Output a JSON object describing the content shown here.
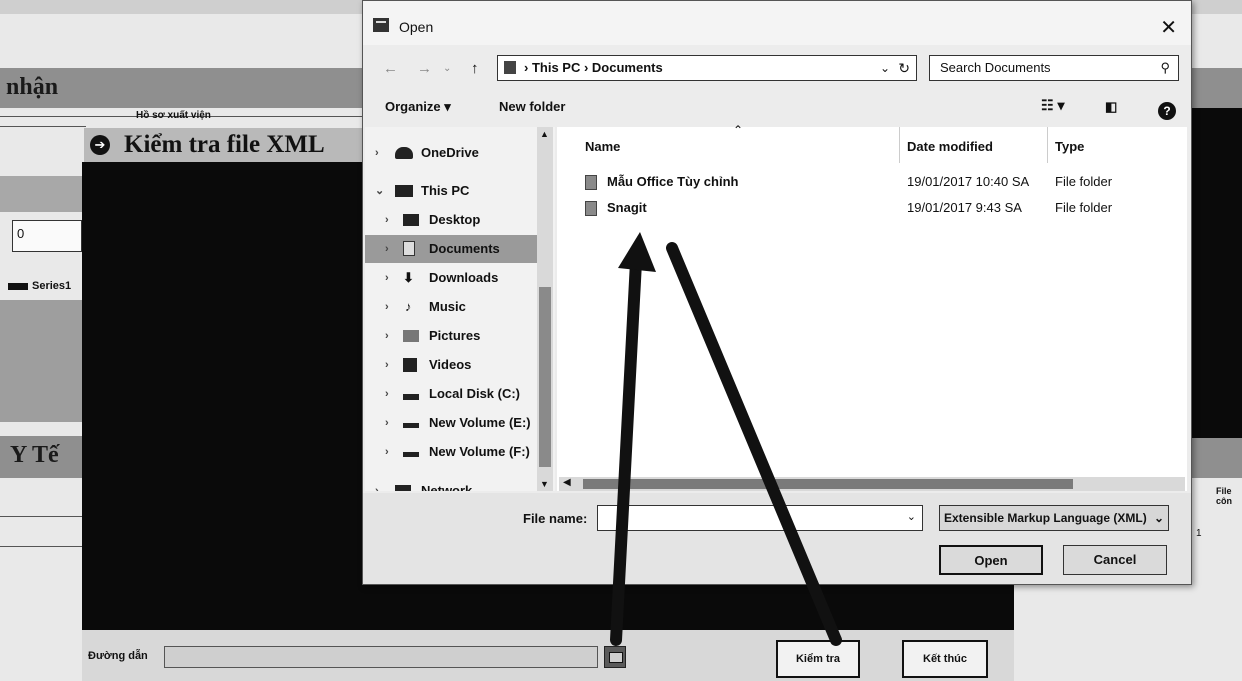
{
  "background_app": {
    "header_partial": "nhận",
    "caption": "Hồ sơ xuất viện",
    "value_field": "0",
    "legend_series": "Series1",
    "section_partial": "Y Tế",
    "right_col_partial": "File côn",
    "right_cell": "1"
  },
  "xml_window": {
    "title": "Kiểm tra file XML",
    "path_label": "Đường dẫn",
    "path_value": "",
    "check_button": "Kiểm tra",
    "exit_button": "Kết thúc"
  },
  "open_dialog": {
    "title": "Open",
    "close": "✕",
    "breadcrumb": [
      "This PC",
      "Documents"
    ],
    "search_placeholder": "Search Documents",
    "organize_label": "Organize ▾",
    "new_folder_label": "New folder",
    "nav_items": [
      {
        "label": "OneDrive",
        "icon": "cloud-icon",
        "arrow": "›"
      },
      {
        "label": "This PC",
        "icon": "computer-icon",
        "arrow": "⌄"
      },
      {
        "label": "Desktop",
        "icon": "desktop-icon",
        "arrow": "›"
      },
      {
        "label": "Documents",
        "icon": "documents-icon",
        "arrow": "›",
        "selected": true
      },
      {
        "label": "Downloads",
        "icon": "download-icon",
        "arrow": "›"
      },
      {
        "label": "Music",
        "icon": "music-icon",
        "arrow": "›"
      },
      {
        "label": "Pictures",
        "icon": "pictures-icon",
        "arrow": "›"
      },
      {
        "label": "Videos",
        "icon": "videos-icon",
        "arrow": "›"
      },
      {
        "label": "Local Disk (C:)",
        "icon": "disk-icon",
        "arrow": "›"
      },
      {
        "label": "New Volume (E:)",
        "icon": "drive-icon",
        "arrow": "›"
      },
      {
        "label": "New Volume (F:)",
        "icon": "drive-icon",
        "arrow": "›"
      },
      {
        "label": "Network",
        "icon": "network-icon",
        "arrow": "›"
      }
    ],
    "columns": {
      "name": "Name",
      "date": "Date modified",
      "type": "Type"
    },
    "files": [
      {
        "name": "Mẫu Office Tùy chỉnh",
        "date": "19/01/2017 10:40 SA",
        "type": "File folder"
      },
      {
        "name": "Snagit",
        "date": "19/01/2017 9:43 SA",
        "type": "File folder"
      }
    ],
    "file_name_label": "File name:",
    "file_name_value": "",
    "file_type_filter": "Extensible Markup Language (XML)",
    "open_button": "Open",
    "cancel_button": "Cancel"
  }
}
